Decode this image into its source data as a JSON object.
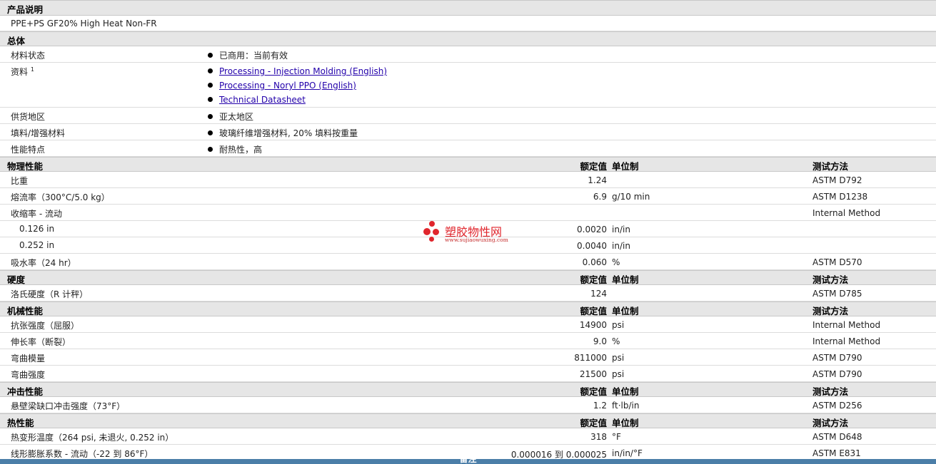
{
  "description": {
    "header": "产品说明",
    "text": "PPE+PS GF20% High Heat Non-FR"
  },
  "general": {
    "header": "总体",
    "rows": [
      {
        "label": "材料状态",
        "value": "已商用：当前有效"
      },
      {
        "label": "资料",
        "sup": "1",
        "links": [
          "Processing - Injection Molding (English)",
          "Processing - Noryl PPO (English)",
          "Technical Datasheet"
        ]
      },
      {
        "label": "供货地区",
        "value": "亚太地区"
      },
      {
        "label": "填料/增强材料",
        "value": "玻璃纤维增强材料, 20% 填料按重量"
      },
      {
        "label": "性能特点",
        "value": "耐热性，高"
      }
    ]
  },
  "columns": {
    "nominal": "额定值",
    "unit": "单位制",
    "test": "测试方法"
  },
  "physical": {
    "header": "物理性能",
    "rows": [
      {
        "label": "比重",
        "value": "1.24",
        "unit": "",
        "test": "ASTM D792"
      },
      {
        "label": "熔流率（300°C/5.0 kg）",
        "value": "6.9",
        "unit": "g/10 min",
        "test": "ASTM D1238"
      },
      {
        "label": "收缩率 - 流动",
        "value": "",
        "unit": "",
        "test": "Internal Method"
      },
      {
        "label": "0.126 in",
        "value": "0.0020",
        "unit": "in/in",
        "test": "",
        "sub": true
      },
      {
        "label": "0.252 in",
        "value": "0.0040",
        "unit": "in/in",
        "test": "",
        "sub": true
      },
      {
        "label": "吸水率（24 hr）",
        "value": "0.060",
        "unit": "%",
        "test": "ASTM D570"
      }
    ]
  },
  "hardness": {
    "header": "硬度",
    "rows": [
      {
        "label": "洛氏硬度（R 计秤）",
        "value": "124",
        "unit": "",
        "test": "ASTM D785"
      }
    ]
  },
  "mechanical": {
    "header": "机械性能",
    "rows": [
      {
        "label": "抗张强度（屈服）",
        "value": "14900",
        "unit": "psi",
        "test": "Internal Method"
      },
      {
        "label": "伸长率（断裂）",
        "value": "9.0",
        "unit": "%",
        "test": "Internal Method"
      },
      {
        "label": "弯曲模量",
        "value": "811000",
        "unit": "psi",
        "test": "ASTM D790"
      },
      {
        "label": "弯曲强度",
        "value": "21500",
        "unit": "psi",
        "test": "ASTM D790"
      }
    ]
  },
  "impact": {
    "header": "冲击性能",
    "rows": [
      {
        "label": "悬壁梁缺口冲击强度（73°F）",
        "value": "1.2",
        "unit": "ft·lb/in",
        "test": "ASTM D256"
      }
    ]
  },
  "thermal": {
    "header": "热性能",
    "rows": [
      {
        "label": "热变形温度（264 psi, 未退火, 0.252 in）",
        "value": "318",
        "unit": "°F",
        "test": "ASTM D648"
      },
      {
        "label": "线形膨胀系数 - 流动（-22 到 86°F）",
        "value": "0.000016 到 0.000025",
        "unit": "in/in/°F",
        "test": "ASTM E831"
      }
    ]
  },
  "notes": {
    "header": "备注"
  },
  "watermark": {
    "title": "塑胶物性网",
    "url": "www.sujiaowuxing.com"
  }
}
